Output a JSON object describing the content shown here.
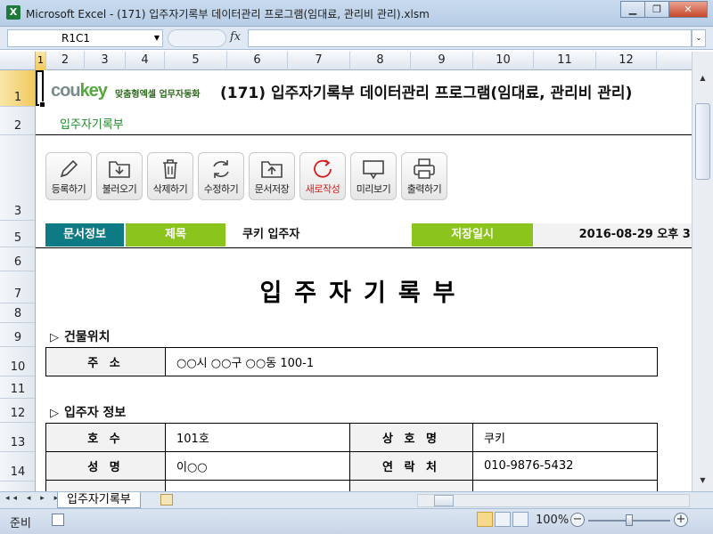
{
  "window": {
    "app_icon": "X",
    "title": "Microsoft Excel - (171) 입주자기록부 데이터관리 프로그램(임대료, 관리비 관리).xlsm",
    "minimize": "▁",
    "restore": "❐",
    "close": "✕"
  },
  "formula_bar": {
    "name_box": "R1C1",
    "fx_label": "fx",
    "formula": ""
  },
  "columns": [
    "1",
    "2",
    "3",
    "4",
    "5",
    "6",
    "7",
    "8",
    "9",
    "10",
    "11",
    "12"
  ],
  "rows": [
    "1",
    "2",
    "3",
    "5",
    "6",
    "7",
    "8",
    "9",
    "10",
    "11",
    "12",
    "13",
    "14",
    ""
  ],
  "sheet": {
    "logo_main": "cou",
    "logo_accent": "key",
    "logo_sub": "맞춤형엑셀 업무자동화",
    "program_title": "(171) 입주자기록부 데이터관리 프로그램(임대료, 관리비 관리)",
    "subtitle": "입주자기록부",
    "toolbar": [
      {
        "label": "등록하기",
        "icon": "pencil-icon"
      },
      {
        "label": "불러오기",
        "icon": "folder-open-icon"
      },
      {
        "label": "삭제하기",
        "icon": "trash-icon"
      },
      {
        "label": "수정하기",
        "icon": "refresh-icon"
      },
      {
        "label": "문서저장",
        "icon": "folder-save-icon"
      },
      {
        "label": "새로작성",
        "icon": "new-doc-icon"
      },
      {
        "label": "미리보기",
        "icon": "monitor-icon"
      },
      {
        "label": "출력하기",
        "icon": "printer-icon"
      }
    ],
    "info": {
      "doc_info_label": "문서정보",
      "title_label": "제목",
      "title_value": "쿠키 입주자",
      "saved_label": "저장일시",
      "saved_value": "2016-08-29  오후 3:"
    },
    "doc_title": "입주자기록부",
    "building_section": "건물위치",
    "address_label": "주 소",
    "address_value": "○○시 ○○구 ○○동 100-1",
    "tenant_section": "입주자 정보",
    "tenant_rows": [
      {
        "k1": "호 수",
        "v1": "101호",
        "k2": "상 호 명",
        "v2": "쿠키"
      },
      {
        "k1": "성 명",
        "v1": "이○○",
        "k2": "연 락 처",
        "v2": "010-9876-5432"
      }
    ]
  },
  "tabs": {
    "nav": "◂◂ ◂ ▸ ▸▸",
    "sheet_name": "입주자기록부"
  },
  "status": {
    "ready": "준비",
    "zoom": "100%",
    "zoom_minus": "−",
    "zoom_plus": "+"
  }
}
